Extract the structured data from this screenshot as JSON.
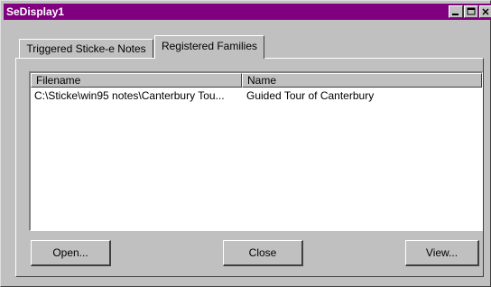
{
  "window": {
    "title": "SeDisplay1"
  },
  "tabs": [
    {
      "label": "Triggered Sticke-e Notes",
      "active": false
    },
    {
      "label": "Registered Families",
      "active": true
    }
  ],
  "list": {
    "columns": [
      "Filename",
      "Name"
    ],
    "rows": [
      {
        "filename": "C:\\Sticke\\win95 notes\\Canterbury Tou...",
        "name": "Guided Tour of Canterbury"
      }
    ]
  },
  "buttons": {
    "open": "Open...",
    "close": "Close",
    "view": "View..."
  },
  "colors": {
    "titlebar": "#800080",
    "face": "#c0c0c0"
  }
}
